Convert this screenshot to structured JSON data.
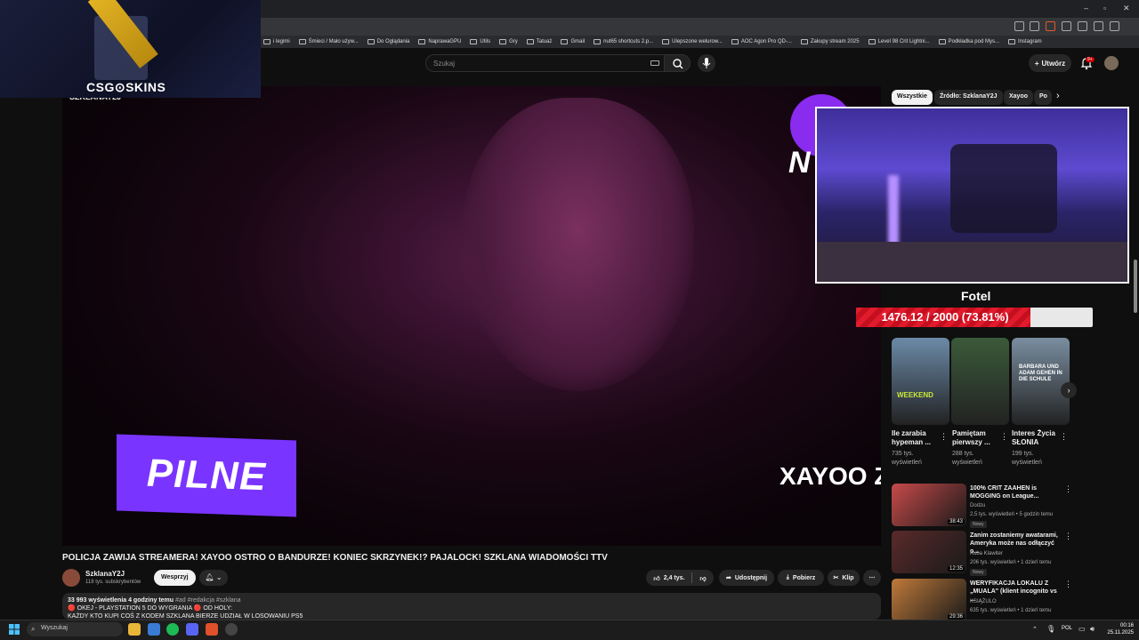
{
  "browser": {
    "window_controls": [
      "–",
      "▫",
      "✕"
    ],
    "bookmarks": [
      "i legimi",
      "Śmieci / Mało używ...",
      "Do Oglądania",
      "NaprawaGPU",
      "Utils",
      "Gry",
      "Tatuaż",
      "Gmail",
      "nut65 shortcuts 2.p...",
      "Ulepszone welurow...",
      "AOC Agon Pro QD-...",
      "Zakupy stream 2025",
      "Level 98 Crit Lightni...",
      "Podkładka pod Mys...",
      "Instagram"
    ]
  },
  "header": {
    "search_placeholder": "Szukaj",
    "create_label": "Utwórz",
    "notifications_badge": "9+"
  },
  "overlay": {
    "logo_text": "CSG⊙SKINS",
    "donation_goal_label": "Fotel",
    "donation_goal_text": "1476.12 / 2000 (73.81%)",
    "donation_progress": 0.7381
  },
  "video": {
    "banner_text": "PILNE",
    "ticker_text": "XAYOO Z",
    "corner_letters": "N",
    "watermark": "SZKLANAY2J",
    "title": "POLICJA ZAWIJA STREAMERA! XAYOO OSTRO O BANDURZE! KONIEC SKRZYNEK!? PAJALOCK! SZKLANA WIADOMOŚCI TTV"
  },
  "channel": {
    "name": "SzklanaY2J",
    "subscribers": "118 tys. subskrybentów",
    "support_label": "Wesprzyj"
  },
  "actions": {
    "likes": "2,4 tys.",
    "share": "Udostępnij",
    "download": "Pobierz",
    "clip": "Klip",
    "more": "⋯"
  },
  "description": {
    "stats": "33 993 wyświetlenia  4 godziny temu",
    "tags": "#ad #redakcja #szklana",
    "line1": "🔴 OKEJ - PLAYSTATION 5 DO WYGRANIA 🔴 OD HOLY:",
    "line2": "KAŻDY KTO KUPI COŚ Z KODEM SZKLANA BIERZE UDZIAŁ W LOSOWANIU PS5"
  },
  "chips": [
    "Wszystkie",
    "Źródło: SzklanaY2J",
    "Xayoo",
    "Po"
  ],
  "shorts": [
    {
      "title": "Ile zarabia hypeman ...",
      "views": "735 tys. wyświetleń",
      "overlay": "WEEKEND",
      "color": "#6b8aa8"
    },
    {
      "title": "Pamiętam pierwszy ...",
      "views": "288 tys. wyświetleń",
      "overlay": "",
      "color": "#3b5a3a"
    },
    {
      "title": "Interes Życia SŁONIA",
      "views": "199 tys. wyświetleń",
      "overlay": "BARBARA UND ADAM GEHEN IN DIE SCHULE",
      "color": "#7a8ea0"
    }
  ],
  "related": [
    {
      "title": "100% CRIT ZAAHEN is MOGGING on League...",
      "channel": "Dodzu",
      "meta": "2,5 tys. wyświetleń • 5 godzin temu",
      "badge": "Nowy",
      "duration": "38:43",
      "color": "#c84a4a"
    },
    {
      "title": "Zanim zostaniemy awatarami, Ameryka może nas odłączyć o...",
      "channel": "Kuba Klawiter",
      "meta": "206 tys. wyświetleń • 1 dzień temu",
      "badge": "Nowy",
      "duration": "12:35",
      "color": "#5a2a2a"
    },
    {
      "title": "WERYFIKACJA LOKALU Z „MUALA\" (klient incognito vs ...",
      "channel": "KSIĄŻULO",
      "meta": "635 tys. wyświetleń • 1 dzień temu",
      "badge": "",
      "duration": "29:36",
      "color": "#c07a3a"
    }
  ],
  "taskbar": {
    "search_label": "Wyszukaj",
    "language": "POL",
    "time": "00:16",
    "date": "25.11.2025"
  },
  "colors": {
    "accent_red": "#cc0000",
    "banner_purple": "#7a34ff",
    "background": "#0f0f0f"
  }
}
